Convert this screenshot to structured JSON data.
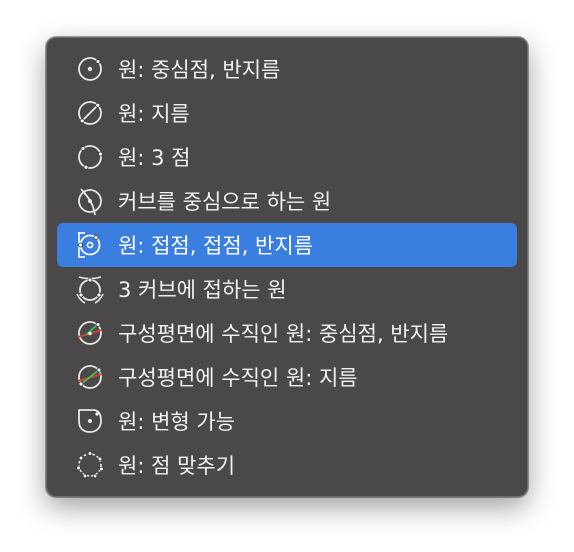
{
  "menu": {
    "items": [
      {
        "label": "원: 중심점, 반지름",
        "icon": "circle-center-radius-icon"
      },
      {
        "label": "원: 지름",
        "icon": "circle-diameter-icon"
      },
      {
        "label": "원: 3 점",
        "icon": "circle-three-points-icon"
      },
      {
        "label": "커브를 중심으로 하는 원",
        "icon": "circle-around-curve-icon"
      },
      {
        "label": "원: 접점, 접점, 반지름",
        "icon": "circle-tangent-tangent-radius-icon",
        "selected": true
      },
      {
        "label": "3 커브에 접하는 원",
        "icon": "circle-tangent-three-curves-icon"
      },
      {
        "label": "구성평면에 수직인 원: 중심점, 반지름",
        "icon": "circle-vertical-center-radius-icon"
      },
      {
        "label": "구성평면에 수직인 원: 지름",
        "icon": "circle-vertical-diameter-icon"
      },
      {
        "label": "원: 변형 가능",
        "icon": "circle-deformable-icon"
      },
      {
        "label": "원: 점 맞추기",
        "icon": "circle-fit-points-icon"
      }
    ]
  },
  "colors": {
    "menu_background": "#4a4848",
    "selection": "#3a7ee0",
    "text": "#f2f2f2",
    "accent_red": "#e03a3a",
    "accent_green": "#3cc24a"
  }
}
